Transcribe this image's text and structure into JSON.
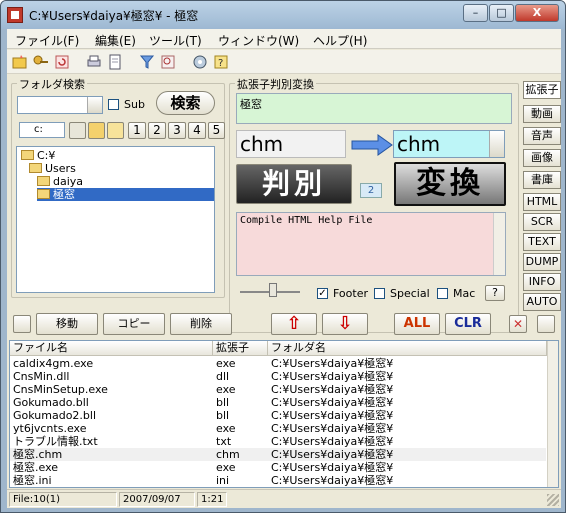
{
  "window": {
    "title": "C:¥Users¥daiya¥極窓¥ - 極窓",
    "controls": {
      "minimize": "–",
      "maximize": "□",
      "close": "X"
    }
  },
  "menu": [
    "ファイル(F)",
    "編集(E)",
    "ツール(T)",
    "ウィンドウ(W)",
    "ヘルプ(H)"
  ],
  "folder_search": {
    "group_label": "フォルダ検索",
    "sub_label": "Sub",
    "search_button": "検索",
    "drive": "c:",
    "num_buttons": [
      "1",
      "2",
      "3",
      "4",
      "5"
    ],
    "tree": [
      "C:¥",
      "Users",
      "daiya",
      "極窓"
    ],
    "selected": "極窓"
  },
  "ext_check": {
    "group_label": "拡張子判別変換",
    "target_name": "極窓",
    "detected_ext": "chm",
    "convert_to": "chm",
    "judge_button": "判別",
    "convert_button": "変換",
    "count_badge": "2",
    "description": "Compile HTML Help File",
    "footer_label": "Footer",
    "special_label": "Special",
    "mac_label": "Mac",
    "help_button": "?"
  },
  "side_tabs": [
    "拡張子",
    "動画",
    "音声",
    "画像",
    "書庫",
    "HTML",
    "SCR",
    "TEXT",
    "DUMP",
    "INFO",
    "AUTO"
  ],
  "action_bar": {
    "move": "移動",
    "copy": "コピー",
    "delete": "削除",
    "all": "ALL",
    "clr": "CLR",
    "up_symbol": "⇧",
    "down_symbol": "⇩"
  },
  "file_list": {
    "columns": [
      "ファイル名",
      "拡張子",
      "フォルダ名"
    ],
    "rows": [
      [
        "caldix4gm.exe",
        "exe",
        "C:¥Users¥daiya¥極窓¥"
      ],
      [
        "CnsMin.dll",
        "dll",
        "C:¥Users¥daiya¥極窓¥"
      ],
      [
        "CnsMinSetup.exe",
        "exe",
        "C:¥Users¥daiya¥極窓¥"
      ],
      [
        "Gokumado.bll",
        "bll",
        "C:¥Users¥daiya¥極窓¥"
      ],
      [
        "Gokumado2.bll",
        "bll",
        "C:¥Users¥daiya¥極窓¥"
      ],
      [
        "yt6jvcnts.exe",
        "exe",
        "C:¥Users¥daiya¥極窓¥"
      ],
      [
        "トラブル情報.txt",
        "txt",
        "C:¥Users¥daiya¥極窓¥"
      ],
      [
        "極窓.chm",
        "chm",
        "C:¥Users¥daiya¥極窓¥"
      ],
      [
        "極窓.exe",
        "exe",
        "C:¥Users¥daiya¥極窓¥"
      ],
      [
        "極窓.ini",
        "ini",
        "C:¥Users¥daiya¥極窓¥"
      ]
    ]
  },
  "status": {
    "files": "File:10(1)",
    "date": "2007/09/07",
    "time": "1:21"
  },
  "colors": {
    "accent_red": "#cc0000",
    "judge_dark": "#333333",
    "convert_dark": "#222222",
    "name_box": "#d7f5d5",
    "desc_box": "#f7dada",
    "ext_box": "#bdf5f7"
  }
}
